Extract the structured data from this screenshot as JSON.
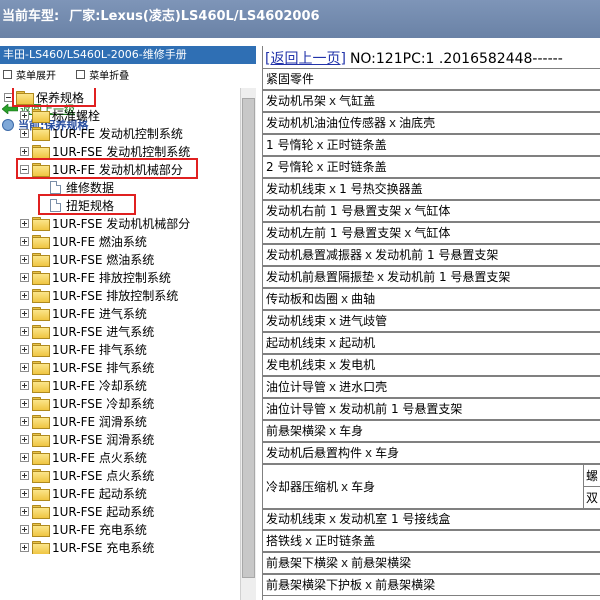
{
  "header": {
    "label": "当前车型:",
    "value": "厂家:Lexus(凌志)LS460L/LS4602006"
  },
  "sidebar": {
    "title": "丰田-LS460/LS460L-2006-维修手册",
    "toolbar": {
      "expand_label": "菜单展开",
      "collapse_label": "菜单折叠"
    },
    "back_label": "返回上一级",
    "current_label": "当前:保养规格",
    "tree": [
      {
        "label": "保养规格",
        "level": 0,
        "kind": "folder",
        "expander": "minus"
      },
      {
        "label": "标准螺栓",
        "level": 1,
        "kind": "folder",
        "expander": "plus"
      },
      {
        "label": "1UR-FE 发动机控制系统",
        "level": 1,
        "kind": "folder",
        "expander": "plus"
      },
      {
        "label": "1UR-FSE 发动机控制系统",
        "level": 1,
        "kind": "folder",
        "expander": "plus"
      },
      {
        "label": "1UR-FE 发动机机械部分",
        "level": 1,
        "kind": "folder",
        "expander": "minus"
      },
      {
        "label": "维修数据",
        "level": 2,
        "kind": "doc",
        "expander": "none"
      },
      {
        "label": "扭矩规格",
        "level": 2,
        "kind": "doc",
        "expander": "none"
      },
      {
        "label": "1UR-FSE 发动机机械部分",
        "level": 1,
        "kind": "folder",
        "expander": "plus"
      },
      {
        "label": "1UR-FE 燃油系统",
        "level": 1,
        "kind": "folder",
        "expander": "plus"
      },
      {
        "label": "1UR-FSE 燃油系统",
        "level": 1,
        "kind": "folder",
        "expander": "plus"
      },
      {
        "label": "1UR-FE 排放控制系统",
        "level": 1,
        "kind": "folder",
        "expander": "plus"
      },
      {
        "label": "1UR-FSE 排放控制系统",
        "level": 1,
        "kind": "folder",
        "expander": "plus"
      },
      {
        "label": "1UR-FE 进气系统",
        "level": 1,
        "kind": "folder",
        "expander": "plus"
      },
      {
        "label": "1UR-FSE 进气系统",
        "level": 1,
        "kind": "folder",
        "expander": "plus"
      },
      {
        "label": "1UR-FE 排气系统",
        "level": 1,
        "kind": "folder",
        "expander": "plus"
      },
      {
        "label": "1UR-FSE 排气系统",
        "level": 1,
        "kind": "folder",
        "expander": "plus"
      },
      {
        "label": "1UR-FE 冷却系统",
        "level": 1,
        "kind": "folder",
        "expander": "plus"
      },
      {
        "label": "1UR-FSE 冷却系统",
        "level": 1,
        "kind": "folder",
        "expander": "plus"
      },
      {
        "label": "1UR-FE 润滑系统",
        "level": 1,
        "kind": "folder",
        "expander": "plus"
      },
      {
        "label": "1UR-FSE 润滑系统",
        "level": 1,
        "kind": "folder",
        "expander": "plus"
      },
      {
        "label": "1UR-FE 点火系统",
        "level": 1,
        "kind": "folder",
        "expander": "plus"
      },
      {
        "label": "1UR-FSE 点火系统",
        "level": 1,
        "kind": "folder",
        "expander": "plus"
      },
      {
        "label": "1UR-FE 起动系统",
        "level": 1,
        "kind": "folder",
        "expander": "plus"
      },
      {
        "label": "1UR-FSE 起动系统",
        "level": 1,
        "kind": "folder",
        "expander": "plus"
      },
      {
        "label": "1UR-FE 充电系统",
        "level": 1,
        "kind": "folder",
        "expander": "plus"
      },
      {
        "label": "1UR-FSE 充电系统",
        "level": 1,
        "kind": "folder",
        "expander": "plus"
      }
    ]
  },
  "content": {
    "back_label": "返回上一页",
    "doc_id": "NO:121PC:1 .2016582448------",
    "rows": [
      {
        "parts": [
          "紧固零件"
        ]
      },
      {
        "parts": [
          "发动机吊架",
          "气缸盖"
        ]
      },
      {
        "parts": [
          "发动机机油油位传感器",
          "油底壳"
        ]
      },
      {
        "parts": [
          "1 号惰轮",
          "正时链条盖"
        ]
      },
      {
        "parts": [
          "2 号惰轮",
          "正时链条盖"
        ]
      },
      {
        "parts": [
          "发动机线束",
          "1 号热交换器盖"
        ]
      },
      {
        "parts": [
          "发动机右前 1 号悬置支架",
          "气缸体"
        ]
      },
      {
        "parts": [
          "发动机左前 1 号悬置支架",
          "气缸体"
        ]
      },
      {
        "parts": [
          "发动机悬置减振器",
          "发动机前 1 号悬置支架"
        ]
      },
      {
        "parts": [
          "发动机前悬置隔振垫",
          "发动机前 1 号悬置支架"
        ]
      },
      {
        "parts": [
          "传动板和齿圈",
          "曲轴"
        ]
      },
      {
        "parts": [
          "发动机线束",
          "进气歧管"
        ]
      },
      {
        "parts": [
          "起动机线束",
          "起动机"
        ]
      },
      {
        "parts": [
          "发电机线束",
          "发电机"
        ]
      },
      {
        "parts": [
          "油位计导管",
          "进水口壳"
        ]
      },
      {
        "parts": [
          "油位计导管",
          "发动机前 1 号悬置支架"
        ]
      },
      {
        "parts": [
          "前悬架横梁",
          "车身"
        ]
      },
      {
        "parts": [
          "发动机后悬置构件",
          "车身"
        ]
      },
      {
        "parts": [
          "冷却器压缩机",
          "车身"
        ],
        "tall": true,
        "sub": [
          "螺",
          "双"
        ]
      },
      {
        "parts": [
          "发动机线束",
          "发动机室 1 号接线盒"
        ]
      },
      {
        "parts": [
          "搭铁线",
          "正时链条盖"
        ]
      },
      {
        "parts": [
          "前悬架下横梁",
          "前悬架横梁"
        ]
      },
      {
        "parts": [
          "前悬架横梁下护板",
          "前悬架横梁"
        ]
      }
    ],
    "separator": "x"
  }
}
